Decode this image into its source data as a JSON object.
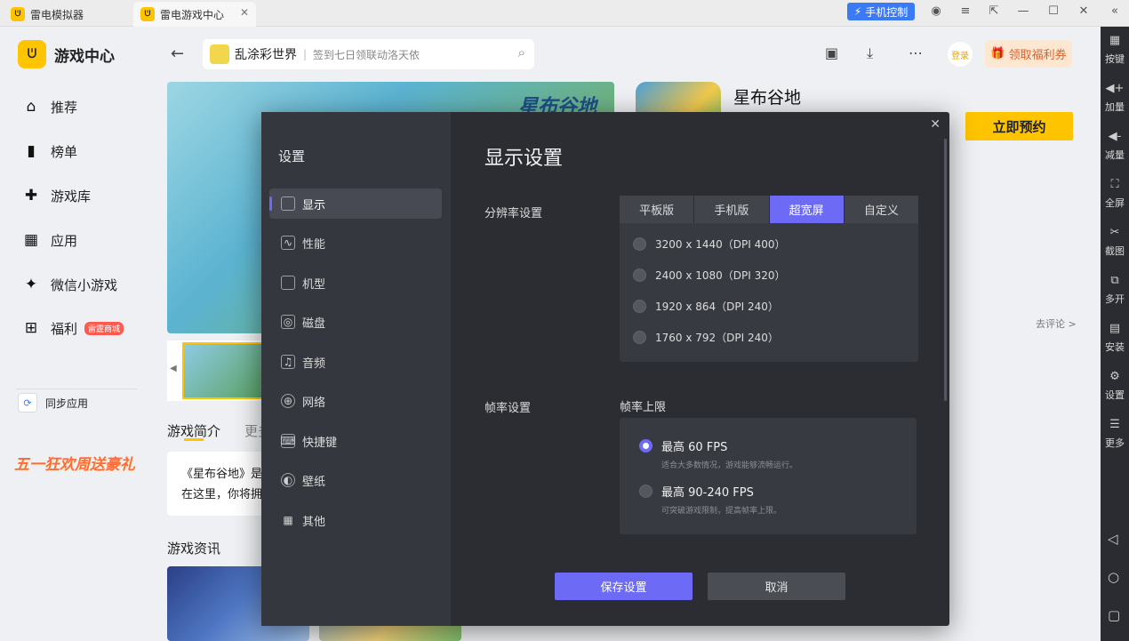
{
  "titlebar": {
    "tab1": "雷电模拟器",
    "tab2": "雷电游戏中心",
    "phone_control": "手机控制"
  },
  "sidebar": {
    "logo": "游戏中心",
    "items": [
      {
        "label": "推荐",
        "icon": "home-icon"
      },
      {
        "label": "榜单",
        "icon": "ranking-icon"
      },
      {
        "label": "游戏库",
        "icon": "gamepad-icon"
      },
      {
        "label": "应用",
        "icon": "apps-icon"
      },
      {
        "label": "微信小游戏",
        "icon": "wechat-game-icon"
      },
      {
        "label": "福利",
        "icon": "gift-icon"
      }
    ],
    "welfare_badge": "雷霆商城",
    "sync": "同步应用",
    "promo": "五一狂欢周送豪礼"
  },
  "header": {
    "search_name": "乱涂彩世界",
    "search_sub": "签到七日领联动洛天依",
    "login": "登录",
    "coupon": "领取福利券"
  },
  "game": {
    "title": "星布谷地",
    "banner_text": "星布谷地",
    "reserve": "立即预约",
    "comment": "去评论 >",
    "tab_intro": "游戏简介",
    "tab_more": "更多",
    "intro_line1": "《星布谷地》是一",
    "intro_line2": "在这里，你将拥有",
    "news_title": "游戏资讯"
  },
  "rightbar": {
    "items": [
      {
        "label": "按键",
        "icon": "keyboard-icon"
      },
      {
        "label": "加量",
        "icon": "volume-up-icon"
      },
      {
        "label": "减量",
        "icon": "volume-down-icon"
      },
      {
        "label": "全屏",
        "icon": "fullscreen-icon"
      },
      {
        "label": "截图",
        "icon": "scissors-icon"
      },
      {
        "label": "多开",
        "icon": "multi-instance-icon"
      },
      {
        "label": "安装",
        "icon": "apk-install-icon"
      },
      {
        "label": "设置",
        "icon": "settings-icon"
      },
      {
        "label": "更多",
        "icon": "more-icon"
      }
    ]
  },
  "settings": {
    "title": "设置",
    "menu": [
      "显示",
      "性能",
      "机型",
      "磁盘",
      "音频",
      "网络",
      "快捷键",
      "壁纸",
      "其他"
    ],
    "heading": "显示设置",
    "resolution_label": "分辨率设置",
    "modes": [
      "平板版",
      "手机版",
      "超宽屏",
      "自定义"
    ],
    "selected_mode": "超宽屏",
    "resolutions": [
      "3200 x 1440（DPI 400）",
      "2400 x 1080（DPI 320）",
      "1920 x 864（DPI 240）",
      "1760 x 792（DPI 240）"
    ],
    "framerate_label": "帧率设置",
    "framerate_cap": "帧率上限",
    "fps_options": [
      {
        "label": "最高 60 FPS",
        "desc": "适合大多数情况，游戏能够流畅运行。"
      },
      {
        "label": "最高 90-240 FPS",
        "desc": "可突破游戏限制，提高帧率上限。"
      }
    ],
    "save": "保存设置",
    "cancel": "取消"
  },
  "colors": {
    "accent": "#6d6bf5",
    "brand_yellow": "#ffc400",
    "modal_bg": "#2b2d33"
  }
}
